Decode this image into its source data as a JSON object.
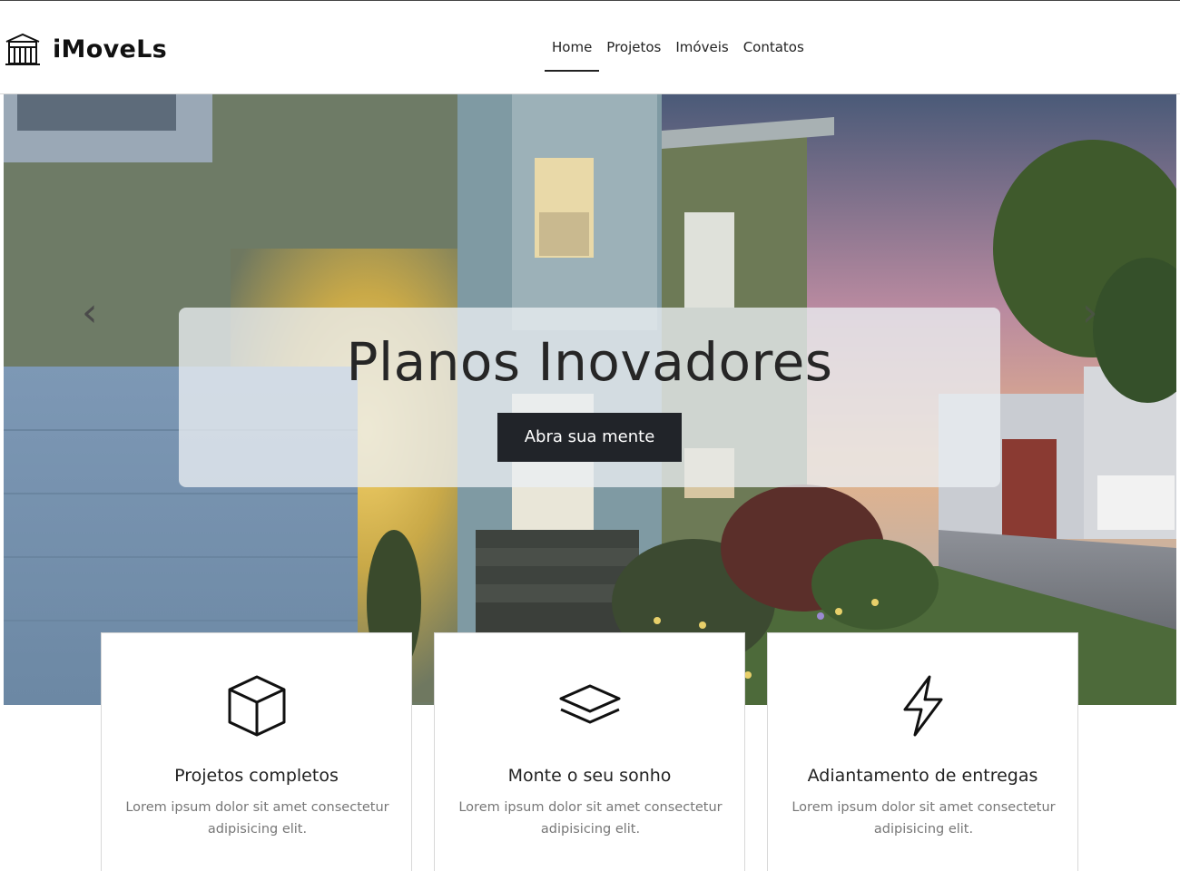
{
  "brand": {
    "name": "iMoveLs",
    "logo_icon": "building-icon"
  },
  "nav": {
    "items": [
      {
        "label": "Home",
        "active": true
      },
      {
        "label": "Projetos",
        "active": false
      },
      {
        "label": "Imóveis",
        "active": false
      },
      {
        "label": "Contatos",
        "active": false
      }
    ]
  },
  "hero": {
    "title": "Planos Inovadores",
    "button_label": "Abra sua mente",
    "prev_label": "‹",
    "next_label": "›",
    "image": "house-at-dusk-photo"
  },
  "features": [
    {
      "icon": "cube-icon",
      "title": "Projetos completos",
      "text": "Lorem ipsum dolor sit amet consectetur adipisicing elit."
    },
    {
      "icon": "layers-icon",
      "title": "Monte o seu sonho",
      "text": "Lorem ipsum dolor sit amet consectetur adipisicing elit."
    },
    {
      "icon": "lightning-icon",
      "title": "Adiantamento de entregas",
      "text": "Lorem ipsum dolor sit amet consectetur adipisicing elit."
    }
  ],
  "colors": {
    "dark_button": "#212429",
    "text": "#222222",
    "muted_text": "#777777"
  }
}
